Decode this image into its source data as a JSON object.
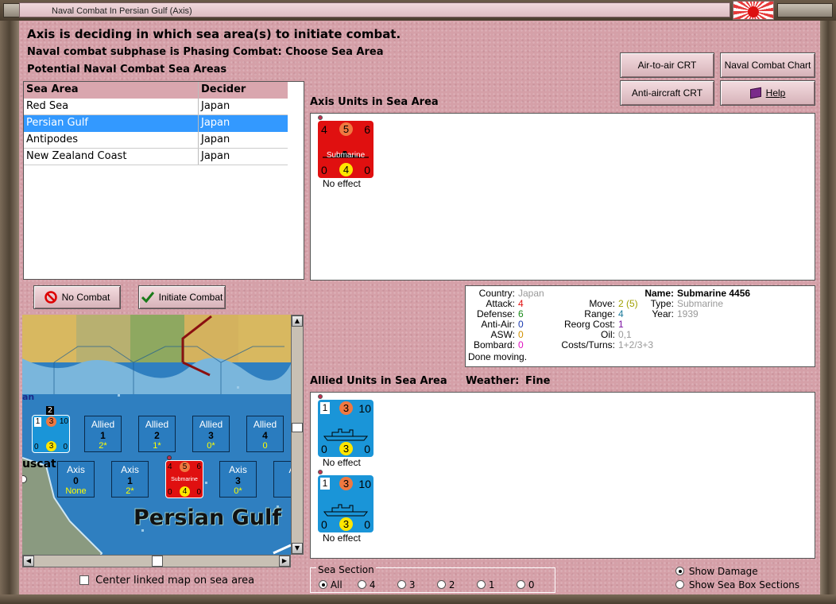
{
  "window": {
    "title": "Naval Combat In Persian Gulf (Axis)"
  },
  "header": {
    "status_line": "Axis is deciding in which sea area(s) to initiate combat.",
    "subphase_line": "Naval combat subphase is Phasing Combat: Choose Sea Area",
    "list_title": "Potential Naval Combat Sea Areas"
  },
  "sea_table": {
    "columns": [
      "Sea Area",
      "Decider"
    ],
    "rows": [
      [
        "Red Sea",
        "Japan"
      ],
      [
        "Persian Gulf",
        "Japan"
      ],
      [
        "Antipodes",
        "Japan"
      ],
      [
        "New Zealand Coast",
        "Japan"
      ]
    ],
    "selected_index": 1
  },
  "buttons": {
    "air_to_air": "Air-to-air CRT",
    "naval_chart": "Naval Combat Chart",
    "anti_aircraft": "Anti-aircraft CRT",
    "help": "Help",
    "no_combat": "No Combat",
    "initiate_combat": "Initiate Combat"
  },
  "axis_panel": {
    "title": "Axis Units in Sea Area",
    "unit": {
      "name": "Submarine",
      "top": [
        "4",
        "5",
        "6"
      ],
      "bottom": [
        "0",
        "4",
        "0"
      ],
      "note": "No effect"
    }
  },
  "allied_panel": {
    "title": "Allied Units in Sea Area",
    "weather_label": "Weather:",
    "weather": "Fine",
    "units": [
      {
        "top": [
          "1",
          "3",
          "10"
        ],
        "bottom": [
          "0",
          "3",
          "0"
        ],
        "note": "No effect"
      },
      {
        "top": [
          "1",
          "3",
          "10"
        ],
        "bottom": [
          "0",
          "3",
          "0"
        ],
        "note": "No effect"
      }
    ]
  },
  "unit_info": {
    "country_label": "Country:",
    "country": "Japan",
    "attack_label": "Attack:",
    "attack": "4",
    "defense_label": "Defense:",
    "defense": "6",
    "antiair_label": "Anti-Air:",
    "antiair": "0",
    "asw_label": "ASW:",
    "asw": "0",
    "bombard_label": "Bombard:",
    "bombard": "0",
    "status": "Done moving.",
    "move_label": "Move:",
    "move": "2 (5)",
    "range_label": "Range:",
    "range": "4",
    "reorg_label": "Reorg Cost:",
    "reorg": "1",
    "oil_label": "Oil:",
    "oil": "0,1",
    "costs_label": "Costs/Turns:",
    "costs": "1+2/3+3",
    "name_label": "Name:",
    "name": "Submarine 4456",
    "type_label": "Type:",
    "type": "Submarine",
    "year_label": "Year:",
    "year": "1939"
  },
  "map": {
    "title": "Persian Gulf",
    "city": "uscat",
    "edge_label": "an",
    "allied_boxes": [
      {
        "label": "Allied",
        "num": "1",
        "sub": "2*"
      },
      {
        "label": "Allied",
        "num": "2",
        "sub": "1*"
      },
      {
        "label": "Allied",
        "num": "3",
        "sub": "0*"
      },
      {
        "label": "Allied",
        "num": "4",
        "sub": "0"
      }
    ],
    "axis_boxes": [
      {
        "label": "Axis",
        "num": "0",
        "sub": "None"
      },
      {
        "label": "Axis",
        "num": "1",
        "sub": "2*"
      },
      {
        "label": "Axis",
        "num": "3",
        "sub": "0*"
      },
      {
        "label": "A",
        "num": "",
        "sub": ""
      }
    ],
    "stack_count": "2",
    "center_checkbox_label": "Center linked map on sea area"
  },
  "sea_section": {
    "label": "Sea Section",
    "options": [
      "All",
      "4",
      "3",
      "2",
      "1",
      "0"
    ],
    "selected": "All"
  },
  "display_options": {
    "show_damage": "Show Damage",
    "show_sea_box": "Show Sea Box Sections",
    "selected": "Show Damage"
  },
  "colors": {
    "background": "#d5a0a8",
    "selection": "#3399ff",
    "axis_counter": "#e01010",
    "allied_counter": "#1a95d8"
  }
}
